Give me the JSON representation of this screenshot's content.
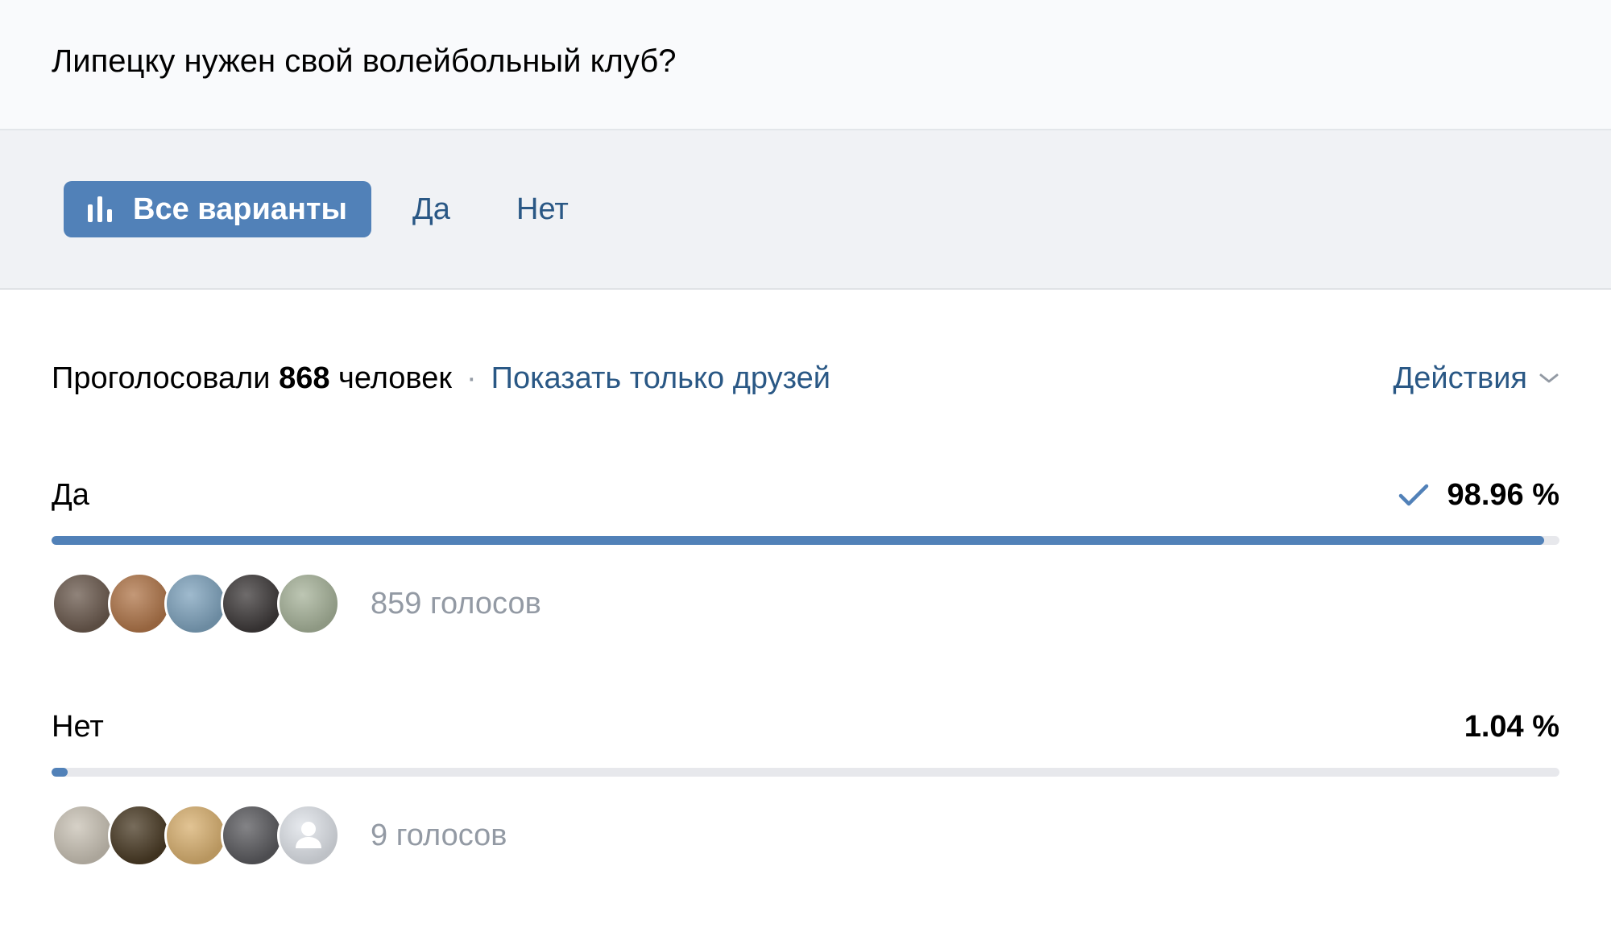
{
  "poll": {
    "question": "Липецку нужен свой волейбольный клуб?"
  },
  "tabs": {
    "all_label": "Все варианты",
    "yes_label": "Да",
    "no_label": "Нет"
  },
  "summary": {
    "prefix": "Проголосовали",
    "count": "868",
    "suffix": "человек",
    "separator": "·",
    "friends_link": "Показать только друзей",
    "actions_label": "Действия"
  },
  "options": [
    {
      "label": "Да",
      "percent_text": "98.96 %",
      "percent_value": 98.96,
      "selected": true,
      "votes_text": "859 голосов",
      "avatar_colors": [
        "#6b5a4e",
        "#b0764a",
        "#7fa3bd",
        "#3e3a3a",
        "#a7b39a"
      ]
    },
    {
      "label": "Нет",
      "percent_text": "1.04 %",
      "percent_value": 1.04,
      "selected": false,
      "votes_text": "9 голосов",
      "avatar_colors": [
        "#c9c2b5",
        "#4a3b25",
        "#d8b070",
        "#5a5a5e",
        "#dfe3e9"
      ]
    }
  ],
  "colors": {
    "accent": "#5181b8",
    "link": "#2a5885",
    "muted": "#939aa4",
    "track": "#e7e8ec"
  }
}
